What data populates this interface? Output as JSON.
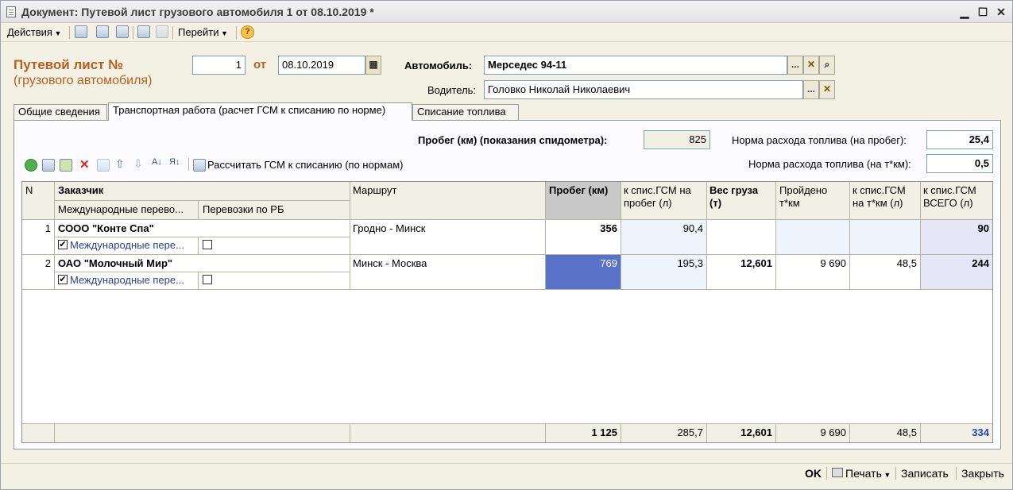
{
  "window": {
    "title": "Документ: Путевой лист грузового автомобиля 1 от 08.10.2019 *"
  },
  "toolbar": {
    "actions_label": "Действия",
    "goto_label": "Перейти",
    "help_label": "?"
  },
  "header": {
    "title": "Путевой лист №",
    "subtitle": "(грузового автомобиля)",
    "number": "1",
    "from_label": "от",
    "date": "08.10.2019",
    "vehicle_label": "Автомобиль:",
    "vehicle_value": "Мерседес 94-11",
    "driver_label": "Водитель:",
    "driver_value": "Головко Николай Николаевич",
    "pick_label": "...",
    "clear_label": "✕",
    "search_label": "🔍"
  },
  "tabs": [
    {
      "label": "Общие сведения"
    },
    {
      "label": "Транспортная работа (расчет ГСМ к списанию по норме)"
    },
    {
      "label": "Списание топлива"
    }
  ],
  "panel": {
    "mileage_label": "Пробег (км) (показания спидометра):",
    "mileage_value": "825",
    "norm_mileage_label": "Норма расхода топлива (на пробег):",
    "norm_mileage_value": "25,4",
    "norm_tkm_label": "Норма расхода топлива (на т*км):",
    "norm_tkm_value": "0,5",
    "calc_label": "Рассчитать ГСМ к списанию (по нормам)"
  },
  "table": {
    "columns": {
      "n": "N",
      "customer": "Заказчик",
      "intl": "Международные перево...",
      "rb": "Перевозки по РБ",
      "route": "Маршрут",
      "mileage": "Пробег (км)",
      "fuel_mileage_1": "к спис.ГСМ на",
      "fuel_mileage_2": "пробег (л)",
      "weight_1": "Вес груза",
      "weight_2": "(т)",
      "tkm_1": "Пройдено",
      "tkm_2": "т*км",
      "fuel_tkm_1": "к спис.ГСМ",
      "fuel_tkm_2": "на т*км (л)",
      "fuel_total_1": "к спис.ГСМ",
      "fuel_total_2": "ВСЕГО (л)"
    },
    "rows": [
      {
        "n": "1",
        "customer": "СООО \"Конте Спа\"",
        "intl_label": "Международные пере...",
        "route": "Гродно - Минск",
        "mileage": "356",
        "fuel_mileage": "90,4",
        "weight": "",
        "tkm": "",
        "fuel_tkm": "",
        "fuel_total": "90"
      },
      {
        "n": "2",
        "customer": "ОАО \"Молочный Мир\"",
        "intl_label": "Международные пере...",
        "route": "Минск - Москва",
        "mileage": "769",
        "fuel_mileage": "195,3",
        "weight": "12,601",
        "tkm": "9 690",
        "fuel_tkm": "48,5",
        "fuel_total": "244"
      }
    ],
    "totals": {
      "mileage": "1 125",
      "fuel_mileage": "285,7",
      "weight": "12,601",
      "tkm": "9 690",
      "fuel_tkm": "48,5",
      "fuel_total": "334"
    }
  },
  "footer": {
    "ok_label": "OK",
    "print_label": "Печать",
    "save_label": "Записать",
    "close_label": "Закрыть"
  }
}
